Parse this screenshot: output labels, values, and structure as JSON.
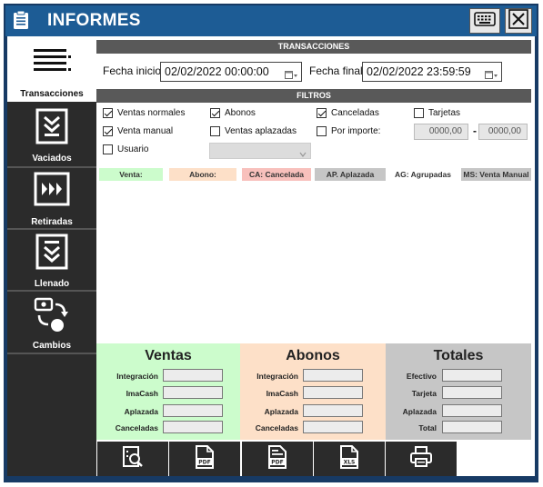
{
  "app": {
    "title": "INFORMES"
  },
  "sidebar": {
    "items": [
      {
        "label": "Transacciones",
        "icon": "menu-lines-icon",
        "active": true
      },
      {
        "label": "Vaciados",
        "icon": "double-chevron-down-icon",
        "active": false
      },
      {
        "label": "Retiradas",
        "icon": "triple-chevron-right-icon",
        "active": false
      },
      {
        "label": "Llenado",
        "icon": "chevron-down-box-icon",
        "active": false
      },
      {
        "label": "Cambios",
        "icon": "exchange-icon",
        "active": false
      }
    ]
  },
  "transacciones": {
    "header": "TRANSACCIONES",
    "fecha_inicio_label": "Fecha inicio",
    "fecha_inicio_value": "02/02/2022 00:00:00",
    "fecha_final_label": "Fecha final",
    "fecha_final_value": "02/02/2022 23:59:59"
  },
  "filtros": {
    "header": "FILTROS",
    "ventas_normales": "Ventas normales",
    "abonos": "Abonos",
    "canceladas": "Canceladas",
    "tarjetas": "Tarjetas",
    "venta_manual": "Venta manual",
    "ventas_aplazadas": "Ventas aplazadas",
    "por_importe": "Por importe:",
    "importe_desde": "0000,00",
    "importe_separator": "-",
    "importe_hasta": "0000,00",
    "usuario": "Usuario"
  },
  "legend": {
    "venta": "Venta:",
    "abono": "Abono:",
    "cancelada": "CA: Cancelada",
    "aplazada": "AP. Aplazada",
    "agrupadas": "AG: Agrupadas",
    "venta_manual": "MS: Venta Manual"
  },
  "totales": {
    "ventas": {
      "title": "Ventas",
      "rows": [
        "Integración",
        "ImaCash",
        "Aplazada",
        "Canceladas"
      ]
    },
    "abonos": {
      "title": "Abonos",
      "rows": [
        "Integración",
        "ImaCash",
        "Aplazada",
        "Canceladas"
      ]
    },
    "totales": {
      "title": "Totales",
      "rows": [
        "Efectivo",
        "Tarjeta",
        "Aplazada",
        "Total"
      ]
    }
  },
  "colors": {
    "venta": "#ccfccc",
    "abono": "#fde0c8",
    "cancelada": "#f8c0bc",
    "aplazada": "#c6c6c6",
    "agrupadas": "#ffffff",
    "venta_manual": "#c6c6c6",
    "titlebar": "#1d5c95",
    "sidebar": "#2b2b2b"
  },
  "toolbar": {
    "buttons": [
      "search-doc-icon",
      "pdf-icon",
      "pdf-list-icon",
      "xls-icon",
      "printer-icon"
    ]
  }
}
